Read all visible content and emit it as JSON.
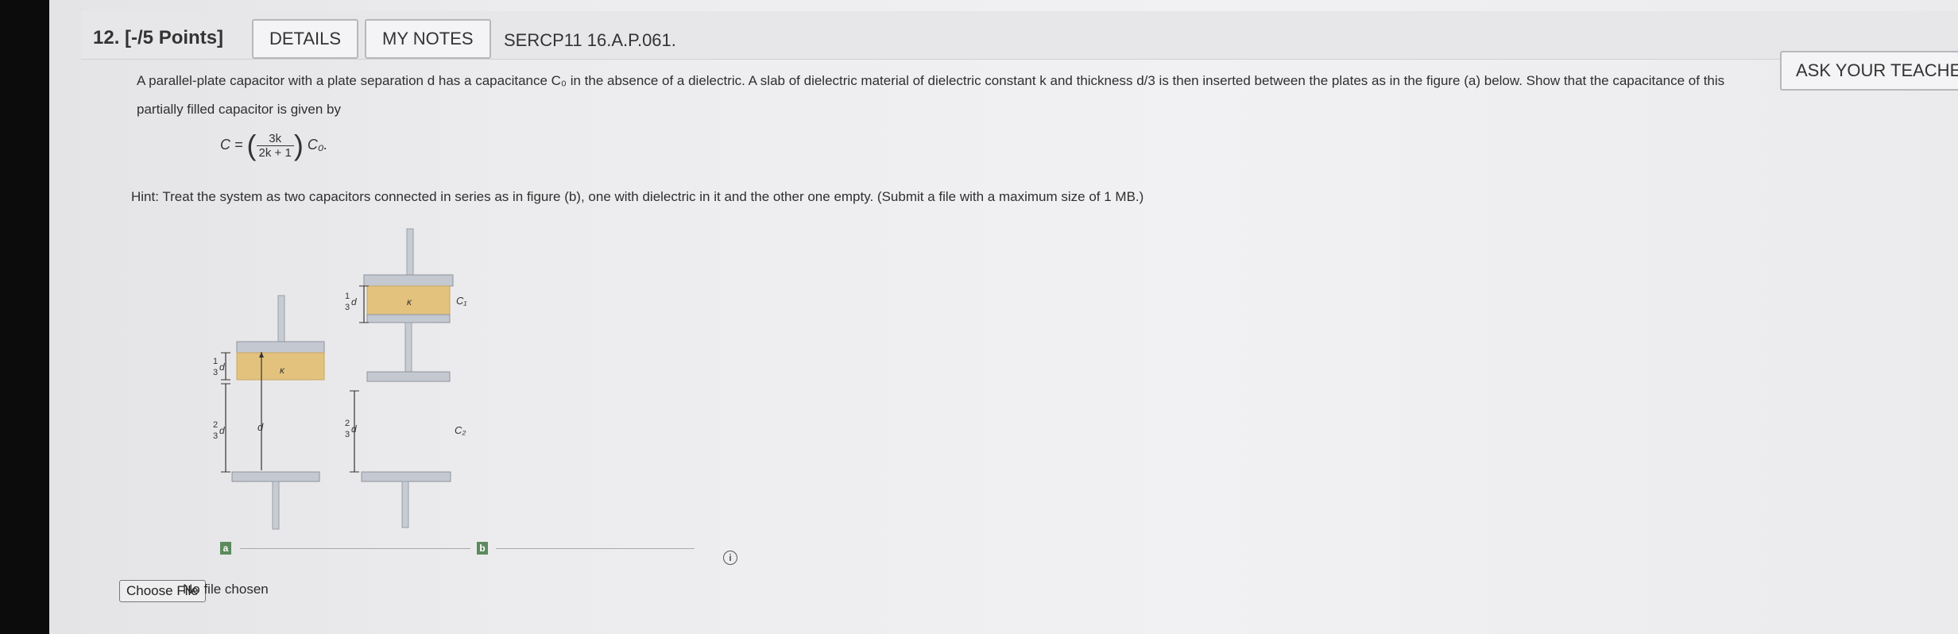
{
  "question": {
    "number": "12. [-/5 Points]",
    "details_label": "DETAILS",
    "notes_label": "MY NOTES",
    "code": "SERCP11 16.A.P.061.",
    "ask_label": "ASK YOUR TEACHER"
  },
  "problem": {
    "line1": "A parallel-plate capacitor with a plate separation d has a capacitance C₀ in the absence of a dielectric. A slab of dielectric material of dielectric constant k and thickness d/3 is then inserted between the plates as in the figure (a) below. Show that the capacitance of this",
    "line2": "partially filled capacitor is given by",
    "formula_lhs": "C =",
    "formula_num": "3k",
    "formula_den": "2k + 1",
    "formula_rhs": "C₀.",
    "hint": "Hint: Treat the system as two capacitors connected in series as in figure (b), one with dielectric in it and the other one empty. (Submit a file with a maximum size of 1 MB.)"
  },
  "figure": {
    "tag_a": "a",
    "tag_b": "b",
    "kappa": "κ",
    "frac_one": "1",
    "frac_two": "2",
    "frac_three": "3",
    "d_label": "d",
    "c1_label": "C₁",
    "c2_label": "C₂",
    "info_icon": "info-icon"
  },
  "upload": {
    "button_label": "Choose File",
    "status": "No file chosen"
  },
  "colors": {
    "dielectric": "#e3c27e",
    "plate": "#b9bec6",
    "tag": "#5c8a5c"
  }
}
